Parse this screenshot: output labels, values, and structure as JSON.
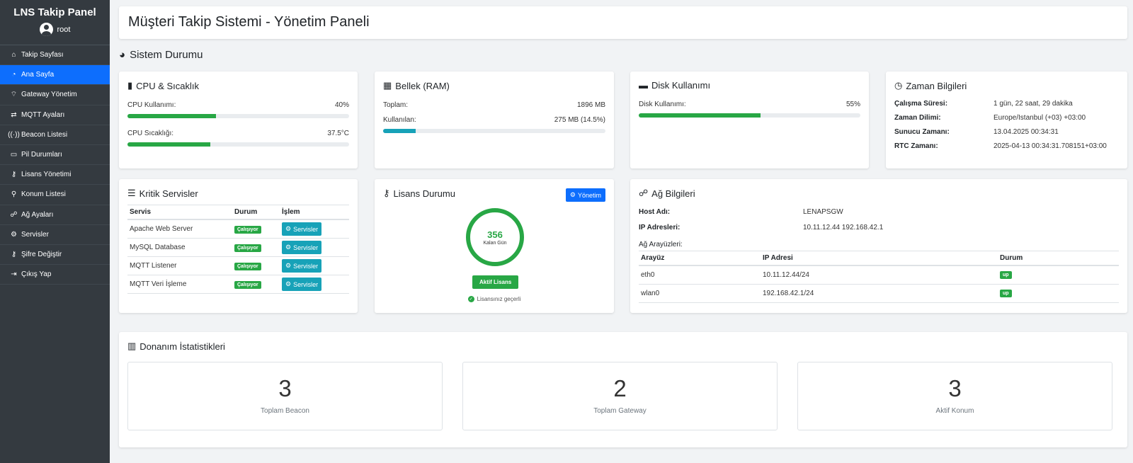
{
  "sidebar": {
    "title": "LNS Takip Panel",
    "user": "root",
    "items": [
      {
        "label": "Takip Sayfası",
        "icon": "home-icon"
      },
      {
        "label": "Ana Sayfa",
        "icon": "dashboard-icon",
        "active": true
      },
      {
        "label": "Gateway Yönetim",
        "icon": "wifi-icon"
      },
      {
        "label": "MQTT Ayaları",
        "icon": "exchange-icon"
      },
      {
        "label": "Beacon Listesi",
        "icon": "broadcast-tower-icon"
      },
      {
        "label": "Pil Durumları",
        "icon": "battery-icon"
      },
      {
        "label": "Lisans Yönetimi",
        "icon": "key-icon"
      },
      {
        "label": "Konum Listesi",
        "icon": "map-marker-icon"
      },
      {
        "label": "Ağ Ayaları",
        "icon": "network-icon"
      },
      {
        "label": "Servisler",
        "icon": "cogs-icon"
      },
      {
        "label": "Şifre Değiştir",
        "icon": "key-icon"
      },
      {
        "label": "Çıkış Yap",
        "icon": "sign-out-icon"
      }
    ]
  },
  "header": {
    "title": "Müşteri Takip Sistemi - Yönetim Paneli"
  },
  "system_status": {
    "title": "Sistem Durumu",
    "cpu": {
      "title": "CPU & Sıcaklık",
      "usage_label": "CPU Kullanımı:",
      "usage_value": "40%",
      "usage_fraction": 0.4,
      "temp_label": "CPU Sıcaklığı:",
      "temp_value": "37.5°C",
      "temp_fraction": 0.375
    },
    "ram": {
      "title": "Bellek (RAM)",
      "total_label": "Toplam:",
      "total_value": "1896 MB",
      "used_label": "Kullanılan:",
      "used_value": "275 MB (14.5%)",
      "used_fraction": 0.145
    },
    "disk": {
      "title": "Disk Kullanımı",
      "usage_label": "Disk Kullanımı:",
      "usage_value": "55%",
      "usage_fraction": 0.55
    },
    "time": {
      "title": "Zaman Bilgileri",
      "rows": [
        {
          "k": "Çalışma Süresi:",
          "v": "1 gün, 22 saat, 29 dakika"
        },
        {
          "k": "Zaman Dilimi:",
          "v": "Europe/Istanbul (+03) +03:00"
        },
        {
          "k": "Sunucu Zamanı:",
          "v": "13.04.2025 00:34:31"
        },
        {
          "k": "RTC Zamanı:",
          "v": "2025-04-13 00:34:31.708151+03:00"
        }
      ]
    }
  },
  "services": {
    "title": "Kritik Servisler",
    "headers": [
      "Servis",
      "Durum",
      "İşlem"
    ],
    "rows": [
      {
        "name": "Apache Web Server",
        "status": "Çalışıyor",
        "action": "Servisler"
      },
      {
        "name": "MySQL Database",
        "status": "Çalışıyor",
        "action": "Servisler"
      },
      {
        "name": "MQTT Listener",
        "status": "Çalışıyor",
        "action": "Servisler"
      },
      {
        "name": "MQTT Veri İşleme",
        "status": "Çalışıyor",
        "action": "Servisler"
      }
    ]
  },
  "license": {
    "title": "Lisans Durumu",
    "manage_label": "Yönetim",
    "days": "356",
    "days_label": "Kalan Gün",
    "status_label": "Aktif Lisans",
    "valid_text": "Lisansınız geçerli"
  },
  "network": {
    "title": "Ağ Bilgileri",
    "host_label": "Host Adı:",
    "host_value": "LENAPSGW",
    "ip_label": "IP Adresleri:",
    "ip_value": "10.11.12.44 192.168.42.1",
    "ifaces_label": "Ağ Arayüzleri:",
    "headers": [
      "Arayüz",
      "IP Adresi",
      "Durum"
    ],
    "rows": [
      {
        "iface": "eth0",
        "ip": "10.11.12.44/24",
        "status": "up"
      },
      {
        "iface": "wlan0",
        "ip": "192.168.42.1/24",
        "status": "up"
      }
    ]
  },
  "hardware": {
    "title": "Donanım İstatistikleri",
    "stats": [
      {
        "value": "3",
        "label": "Toplam Beacon"
      },
      {
        "value": "2",
        "label": "Toplam Gateway"
      },
      {
        "value": "3",
        "label": "Aktif Konum"
      }
    ]
  },
  "colors": {
    "primary": "#0d6efd",
    "success": "#28a745",
    "info": "#17a2b8",
    "sidebar": "#343a40"
  }
}
